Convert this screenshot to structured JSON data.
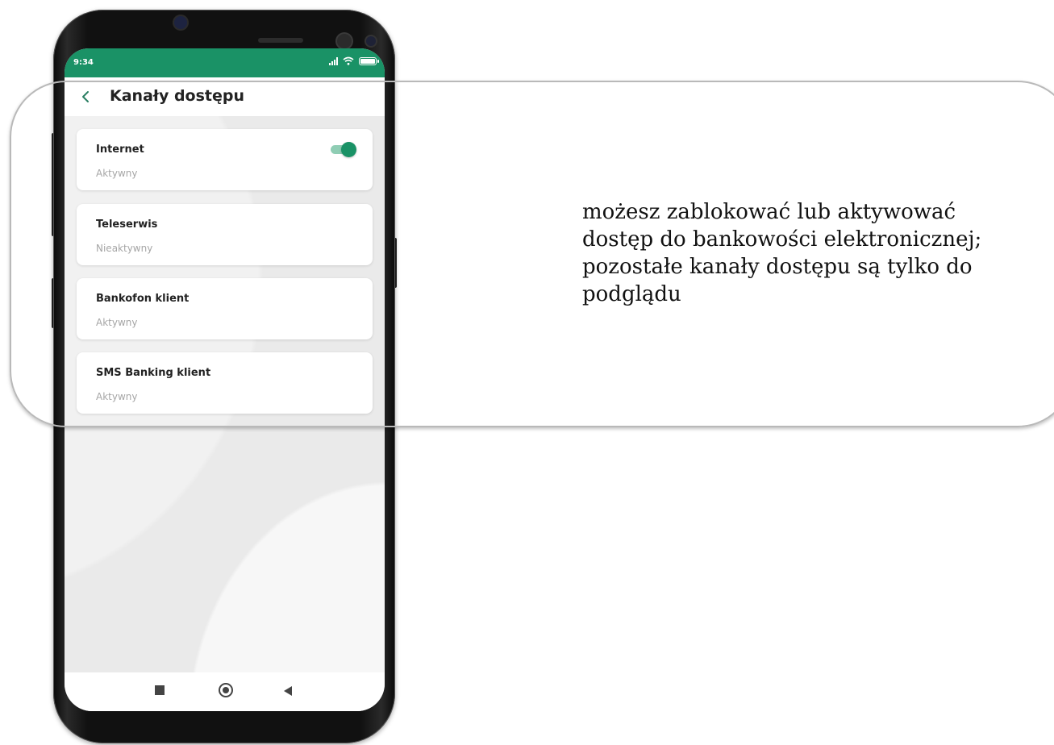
{
  "status_bar": {
    "time": "9:34"
  },
  "header": {
    "title": "Kanały dostępu"
  },
  "channels": [
    {
      "name": "Internet",
      "status": "Aktywny",
      "toggle_on": true
    },
    {
      "name": "Teleserwis",
      "status": "Nieaktywny"
    },
    {
      "name": "Bankofon klient",
      "status": "Aktywny"
    },
    {
      "name": "SMS Banking klient",
      "status": "Aktywny"
    }
  ],
  "callout": {
    "lines": [
      "możesz zablokować lub aktywować",
      "dostęp do bankowości elektronicznej;",
      "pozostałe kanały dostępu są tylko do",
      "podglądu"
    ]
  },
  "colors": {
    "accent": "#1a9266",
    "toggle_track": "#8fcdb4",
    "muted_text": "#a6a6a6"
  },
  "icons": {
    "back": "chevron-left-icon",
    "nav": [
      "square-icon",
      "circle-icon",
      "triangle-back-icon"
    ]
  }
}
